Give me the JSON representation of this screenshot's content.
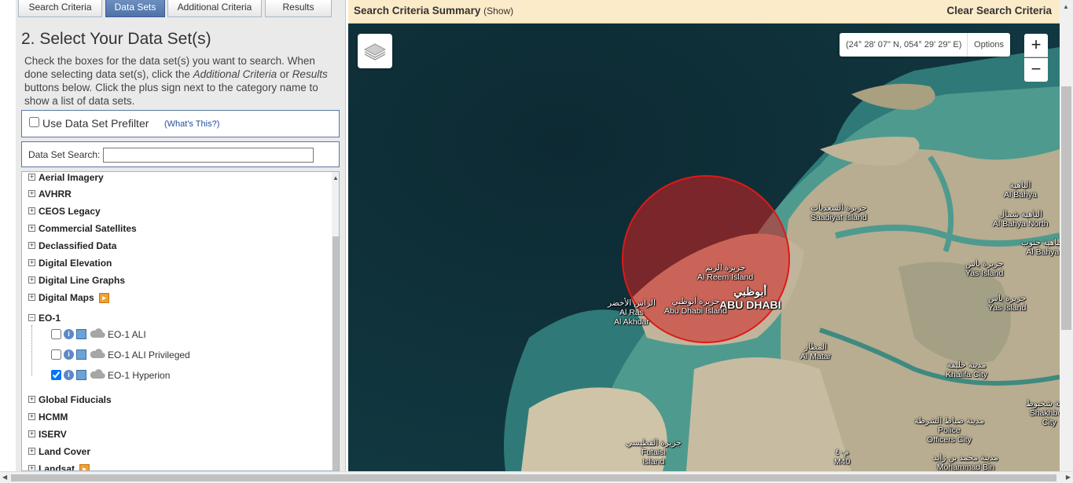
{
  "tabs": [
    {
      "label": "Search Criteria"
    },
    {
      "label": "Data Sets"
    },
    {
      "label": "Additional Criteria"
    },
    {
      "label": "Results"
    }
  ],
  "heading": "2. Select Your Data Set(s)",
  "instructions": {
    "p1": "Check the boxes for the data set(s) you want to search. When done selecting data set(s), click the ",
    "em1": "Additional Criteria",
    "p2": " or ",
    "em2": "Results",
    "p3": " buttons below. Click the plus sign next to the category name to show a list of data sets."
  },
  "prefilter": {
    "label": "Use Data Set Prefilter",
    "help": "(What's This?)"
  },
  "dataset_search": {
    "label": "Data Set Search:",
    "value": ""
  },
  "categories": [
    {
      "label": "Aerial Imagery"
    },
    {
      "label": "AVHRR"
    },
    {
      "label": "CEOS Legacy"
    },
    {
      "label": "Commercial Satellites"
    },
    {
      "label": "Declassified Data"
    },
    {
      "label": "Digital Elevation"
    },
    {
      "label": "Digital Line Graphs"
    },
    {
      "label": "Digital Maps"
    },
    {
      "label": "EO-1"
    },
    {
      "label": "Global Fiducials"
    },
    {
      "label": "HCMM"
    },
    {
      "label": "ISERV"
    },
    {
      "label": "Land Cover"
    },
    {
      "label": "Landsat"
    }
  ],
  "eo1_datasets": [
    {
      "label": "EO-1 ALI",
      "checked": false
    },
    {
      "label": "EO-1 ALI Privileged",
      "checked": false
    },
    {
      "label": "EO-1 Hyperion",
      "checked": true
    }
  ],
  "map": {
    "summary_title": "Search Criteria Summary",
    "summary_show": "(Show)",
    "clear": "Clear Search Criteria",
    "coords": "(24° 28' 07\" N, 054° 29' 29\" E)",
    "options": "Options",
    "zoom_in": "+",
    "zoom_out": "−",
    "labels": {
      "saadiyat_ar": "جزيرة السعديات",
      "saadiyat": "Saadiyat Island",
      "bahya_ar": "الباهية",
      "bahya": "Al Bahya",
      "bahya_north_ar": "الباهية شمال",
      "bahya_north": "Al Bahya North",
      "bahya_south_ar": "الباهية جنوب",
      "bahya_south": "Al Bahya",
      "yas1_ar": "جزيرة ياس",
      "yas1": "Yas Island",
      "yas2_ar": "جزيرة ياس",
      "yas2": "Yas Island",
      "reem_ar": "جزيرة الريم",
      "reem": "Al Reem Island",
      "abudhabi_ar": "أبوظبي",
      "abudhabi": "ABU DHABI",
      "island_ar": "جزيرة أبوظبي",
      "island": "Abu Dhabi Island",
      "ras_ar": "الراس الأخضر",
      "ras": "Al Ras",
      "akhdar": "Al Akhdar",
      "matar_ar": "المطار",
      "matar": "Al Matar",
      "khalifa_ar": "مدينة خليفة",
      "khalifa": "Khalifa City",
      "shakhbout_ar": "مدينة شخبوط",
      "shakhbout": "Shakhbout",
      "shakhbout_city": "City",
      "police_ar": "مدينة ضباط الشرطة",
      "police": "Police",
      "police_city": "Officers City",
      "futaisi_ar": "جزيرة الفطيسي",
      "futaisi": "Futaisi",
      "futaisi_island": "Island",
      "m40_ar": "م٤٠",
      "m40": "M40",
      "mbz_ar": "مدينة محمد بن زايد",
      "mbz": "Mohammad Bin"
    }
  },
  "colors": {
    "tab_active": "#4e73a8",
    "summary_bar": "#fcebc8",
    "search_circle": "#d42020"
  }
}
